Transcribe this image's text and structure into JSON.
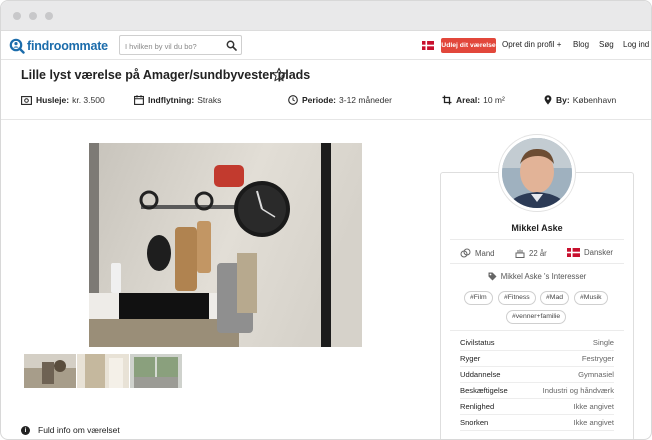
{
  "nav": {
    "logo": "findroommate",
    "search_placeholder": "I hvilken by vil du bo?",
    "rent_button": "Udlej dit værelse",
    "links": [
      "Opret din profil +",
      "Blog",
      "Søg",
      "Log ind"
    ]
  },
  "listing": {
    "title": "Lille lyst værelse på Amager/sundbyvester plads",
    "facts": [
      {
        "label": "Husleje:",
        "value": "kr. 3.500",
        "icon": "money-icon"
      },
      {
        "label": "Indflytning:",
        "value": "Straks",
        "icon": "calendar-icon"
      },
      {
        "label": "Periode:",
        "value": "3-12 måneder",
        "icon": "clock-icon"
      },
      {
        "label": "Areal:",
        "value": "10 m²",
        "icon": "crop-icon"
      },
      {
        "label": "By:",
        "value": "København",
        "icon": "map-pin-icon"
      }
    ],
    "full_info": "Fuld info om værelset"
  },
  "profile": {
    "name": "Mikkel Aske",
    "gender": "Mand",
    "age": "22 år",
    "nationality": "Dansker",
    "interests_title": "Mikkel Aske 's Interesser",
    "tags": [
      "#Film",
      "#Fitness",
      "#Mad",
      "#Musik",
      "#venner+familie"
    ],
    "details": [
      {
        "key": "Civilstatus",
        "value": "Single"
      },
      {
        "key": "Ryger",
        "value": "Festryger"
      },
      {
        "key": "Uddannelse",
        "value": "Gymnasiel"
      },
      {
        "key": "Beskæftigelse",
        "value": "Industri og håndværk"
      },
      {
        "key": "Renlighed",
        "value": "Ikke angivet"
      },
      {
        "key": "Snorken",
        "value": "Ikke angivet"
      }
    ]
  },
  "colors": {
    "brand": "#1b6cab",
    "accent": "#e2473b",
    "flag_red": "#c8102e"
  }
}
